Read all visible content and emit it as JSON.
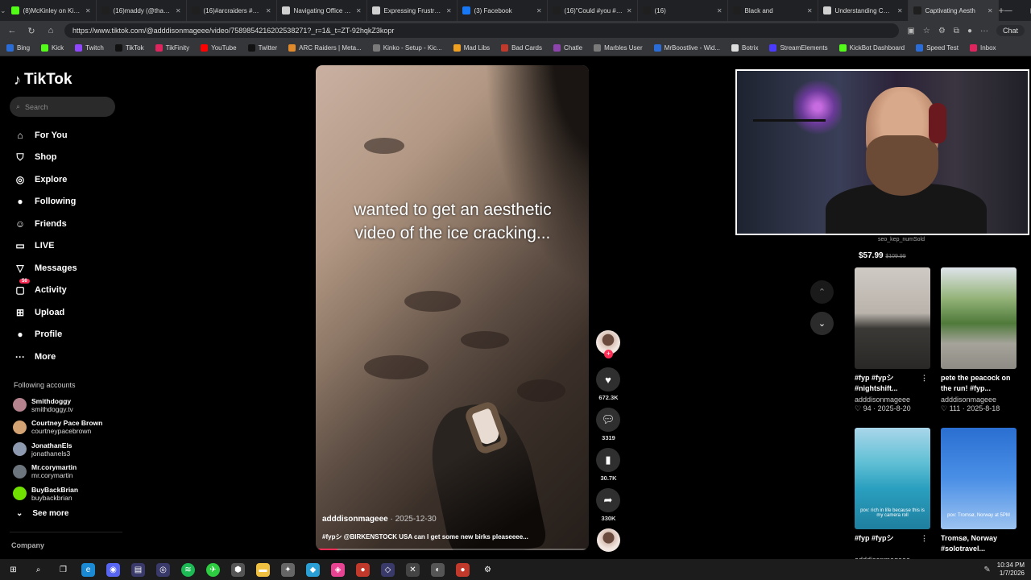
{
  "browser": {
    "tabs": [
      {
        "title": "(8)McKinley on Kick (@",
        "color": "#53fc18"
      },
      {
        "title": "(16)maddy (@thatfunn",
        "color": "#1f1f1f"
      },
      {
        "title": "(16)#arcraiders #arcrai",
        "color": "#1f1f1f"
      },
      {
        "title": "Navigating Office Cultu",
        "color": "#d0d0d0"
      },
      {
        "title": "Expressing Frustration",
        "color": "#d0d0d0"
      },
      {
        "title": "(3) Facebook",
        "color": "#1877f2"
      },
      {
        "title": "(16)\"Could #you #elab",
        "color": "#1f1f1f"
      },
      {
        "title": "(16)",
        "color": "#1f1f1f"
      },
      {
        "title": "Black and",
        "color": "#1f1f1f"
      },
      {
        "title": "Understanding Consen",
        "color": "#d0d0d0"
      },
      {
        "title": "Captivating Aesth",
        "color": "#1f1f1f"
      }
    ],
    "url": "https://www.tiktok.com/@adddisonmageee/video/7589854216202538271?_r=1&_t=ZT-92hqkZ3kopr",
    "chat_label": "Chat",
    "bookmarks": [
      {
        "label": "Bing",
        "color": "#2b6dd8"
      },
      {
        "label": "Kick",
        "color": "#53fc18"
      },
      {
        "label": "Twitch",
        "color": "#9146ff"
      },
      {
        "label": "TikTok",
        "color": "#111111"
      },
      {
        "label": "TikFinity",
        "color": "#e0245e"
      },
      {
        "label": "YouTube",
        "color": "#ff0000"
      },
      {
        "label": "Twitter",
        "color": "#111111"
      },
      {
        "label": "ARC Raiders | Meta...",
        "color": "#e08a2b"
      },
      {
        "label": "Kinko - Setup - Kic...",
        "color": "#7a7a7a"
      },
      {
        "label": "Mad Libs",
        "color": "#f0a020"
      },
      {
        "label": "Bad Cards",
        "color": "#c0392b"
      },
      {
        "label": "Chatle",
        "color": "#8e44ad"
      },
      {
        "label": "Marbles User",
        "color": "#7a7a7a"
      },
      {
        "label": "MrBoostlive - Wid...",
        "color": "#2b6dd8"
      },
      {
        "label": "Botrix",
        "color": "#dddddd"
      },
      {
        "label": "StreamElements",
        "color": "#4b3bff"
      },
      {
        "label": "KickBot Dashboard",
        "color": "#53fc18"
      },
      {
        "label": "Speed Test",
        "color": "#2b6dd8"
      },
      {
        "label": "Inbox",
        "color": "#e0245e"
      }
    ]
  },
  "sidebar": {
    "logo": "TikTok",
    "search_placeholder": "Search",
    "nav": [
      {
        "label": "For You",
        "icon": "home-icon",
        "glyph": "⌂"
      },
      {
        "label": "Shop",
        "icon": "shop-icon",
        "glyph": "⛉"
      },
      {
        "label": "Explore",
        "icon": "explore-icon",
        "glyph": "◎"
      },
      {
        "label": "Following",
        "icon": "following-avatar-icon",
        "glyph": "●"
      },
      {
        "label": "Friends",
        "icon": "friends-icon",
        "glyph": "☺"
      },
      {
        "label": "LIVE",
        "icon": "live-icon",
        "glyph": "▭"
      },
      {
        "label": "Messages",
        "icon": "messages-icon",
        "glyph": "▽"
      },
      {
        "label": "Activity",
        "icon": "activity-icon",
        "glyph": "▢",
        "badge": "56"
      },
      {
        "label": "Upload",
        "icon": "upload-icon",
        "glyph": "⊞"
      },
      {
        "label": "Profile",
        "icon": "profile-icon",
        "glyph": "●"
      },
      {
        "label": "More",
        "icon": "more-icon",
        "glyph": "···"
      }
    ],
    "following_title": "Following accounts",
    "accounts": [
      {
        "name": "Smithdoggy",
        "handle": "smithdoggy.tv",
        "color": "#b5838d"
      },
      {
        "name": "Courtney Pace Brown",
        "handle": "courtneypacebrown",
        "color": "#d4a373"
      },
      {
        "name": "JonathanEls",
        "handle": "jonathanels3",
        "color": "#8d99ae"
      },
      {
        "name": "Mr.corymartin",
        "handle": "mr.corymartin",
        "color": "#6c757d"
      },
      {
        "name": "BuyBackBrian",
        "handle": "buybackbrian",
        "color": "#70e000"
      }
    ],
    "see_more": "See more",
    "company": "Company"
  },
  "video": {
    "caption": "wanted to get an aesthetic video of the ice cracking...",
    "author": "adddisonmageee",
    "date": "· 2025-12-30",
    "description": "#fypシ @BIRKENSTOCK USA can I get some new birks pleaseeee...",
    "progress": 0.08,
    "likes": "672.3K",
    "comments": "3319",
    "saves": "30.7K",
    "shares": "330K"
  },
  "right": {
    "shop_label": "seo_kep_numSold",
    "price": "$57.99",
    "old_price": "$109.99",
    "cards": [
      {
        "title": "#fyp #fypシ #nightshift...",
        "author": "adddisonmageee",
        "likes": "94",
        "date": "2025-8-20",
        "thumb_caption": ""
      },
      {
        "title": "pete the peacock on the run! #fyp...",
        "author": "adddisonmageee",
        "likes": "111",
        "date": "2025-8-18",
        "thumb_caption": ""
      },
      {
        "title": "#fyp #fypシ",
        "author": "adddisonmageee",
        "likes": "",
        "date": "",
        "thumb_caption": "pov: rich in life because this is my camera roll"
      },
      {
        "title": "Tromsø, Norway #solotravel...",
        "author": "",
        "likes": "",
        "date": "",
        "thumb_caption": "pov: Tromsø, Norway at 5PM"
      }
    ]
  },
  "taskbar": {
    "time": "10:34 PM",
    "date": "1/7/2026"
  },
  "colors": {
    "accent": "#fe2c55",
    "background": "#000000",
    "chrome": "#35363a"
  }
}
